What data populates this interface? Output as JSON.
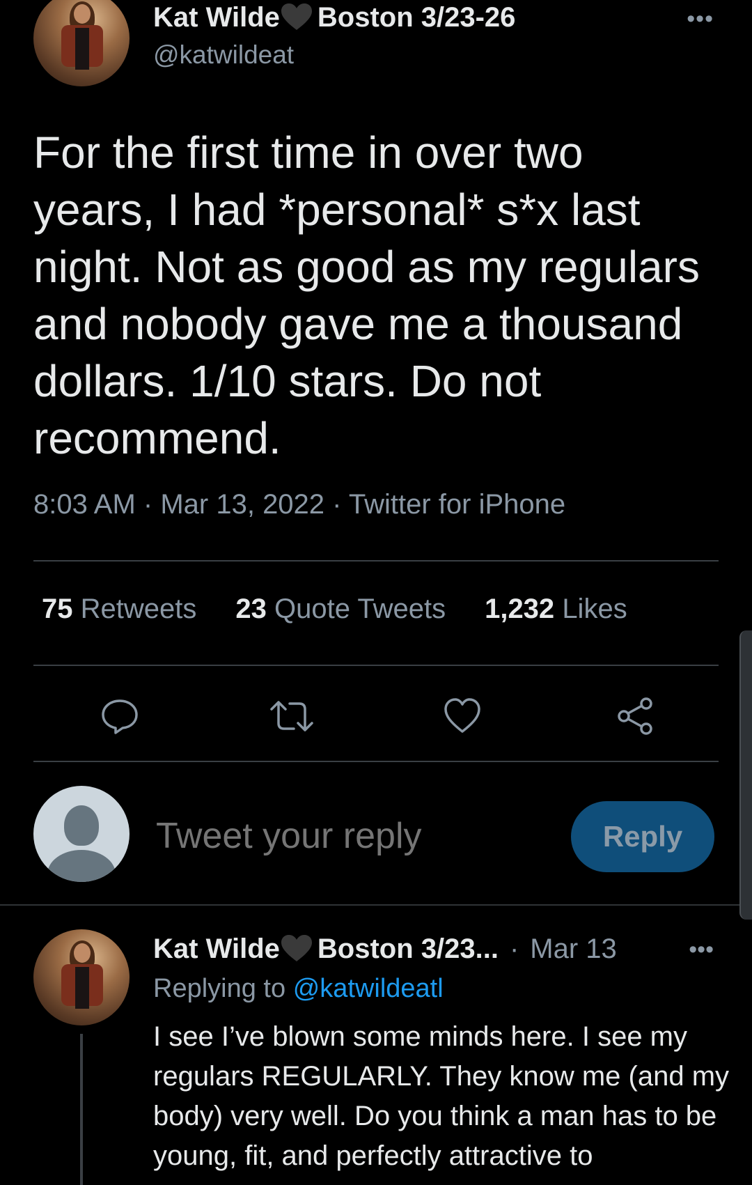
{
  "tweet": {
    "author_name": "Kat Wilde",
    "author_name_suffix": "Boston 3/23-26",
    "handle": "@katwildeat",
    "more_label": "•••",
    "text": "For the first time in over two\nyears, I had *personal* s*x last\nnight. Not as good as my regulars\nand nobody gave me a thousand\ndollars. 1/10 stars. Do not\nrecommend.",
    "time": "8:03 AM",
    "date": "Mar 13, 2022",
    "source": "Twitter for iPhone",
    "separator": "·"
  },
  "stats": {
    "retweets_count": "75",
    "retweets_label": "Retweets",
    "quotes_count": "23",
    "quotes_label": "Quote Tweets",
    "likes_count": "1,232",
    "likes_label": "Likes"
  },
  "actions": {
    "icons": [
      "reply-icon",
      "retweet-icon",
      "like-icon",
      "share-icon"
    ]
  },
  "composer": {
    "placeholder": "Tweet your reply",
    "button_label": "Reply"
  },
  "reply": {
    "author_name": "Kat Wilde",
    "author_name_suffix": "Boston 3/23...",
    "date": "Mar 13",
    "separator": "·",
    "more_label": "•••",
    "replying_prefix": "Replying to",
    "replying_handle": "@katwildeatl",
    "text": "I see I’ve blown some minds here. I see my regulars REGULARLY. They know me (and my body) very well. Do you think a man has to be young, fit, and perfectly attractive to"
  },
  "colors": {
    "background": "#000000",
    "text_primary": "#e7e9ea",
    "text_secondary": "#8b98a5",
    "accent": "#1d9bf0",
    "reply_button_bg": "#0f4e7a",
    "divider": "#3a3f44"
  }
}
